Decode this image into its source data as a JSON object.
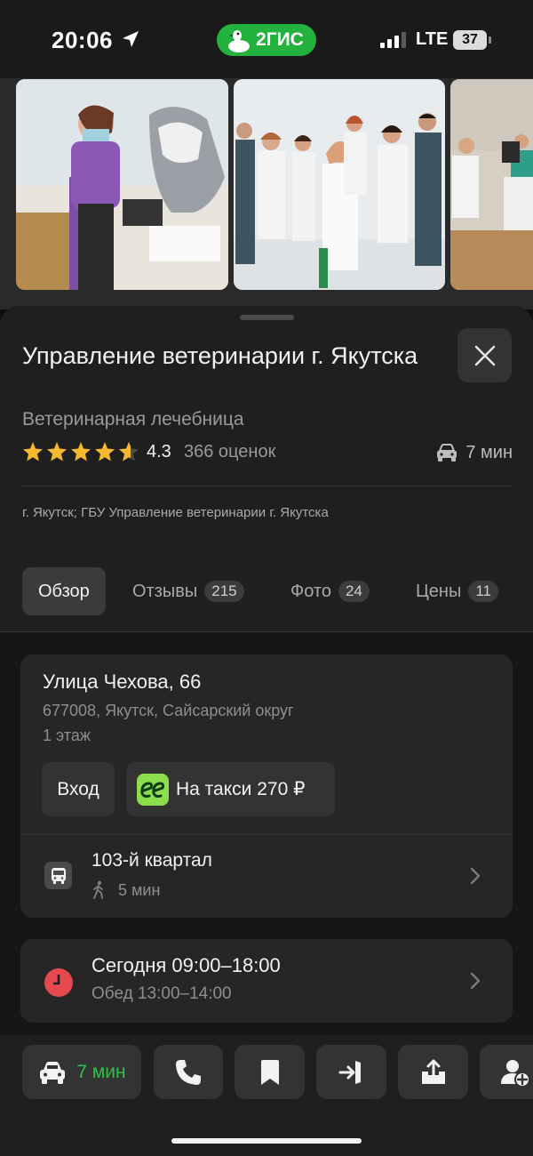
{
  "status_bar": {
    "time": "20:06",
    "app_badge": "2ГИС",
    "network": "LTE",
    "battery": "37"
  },
  "photos": [
    {
      "name": "vet-reception-photo"
    },
    {
      "name": "vet-staff-group-photo"
    },
    {
      "name": "vet-office-photo"
    }
  ],
  "place": {
    "title": "Управление ветеринарии г. Якутска",
    "category": "Ветеринарная лечебница",
    "rating": "4.3",
    "rating_value": 4.3,
    "rating_count": "366 оценок",
    "drive_time": "7 мин",
    "org": "г. Якутск; ГБУ Управление ветеринарии г. Якутска"
  },
  "tabs": [
    {
      "label": "Обзор",
      "count": ""
    },
    {
      "label": "Отзывы",
      "count": "215"
    },
    {
      "label": "Фото",
      "count": "24"
    },
    {
      "label": "Цены",
      "count": "11"
    }
  ],
  "address": {
    "street": "Улица Чехова, 66",
    "city_line": "677008, Якутск, Сайсарский округ",
    "floor": "1 этаж",
    "entrance_label": "Вход",
    "taxi_label": "На такси 270 ₽",
    "stop_name": "103-й квартал",
    "stop_walk": "5 мин"
  },
  "hours": {
    "today": "Сегодня 09:00–18:00",
    "lunch": "Обед 13:00–14:00"
  },
  "actions": {
    "drive_label": "7 мин"
  },
  "colors": {
    "accent_green": "#24b23e",
    "star": "#f5b82e",
    "clock_red": "#e5484d",
    "taxi_green": "#8dde4c"
  }
}
